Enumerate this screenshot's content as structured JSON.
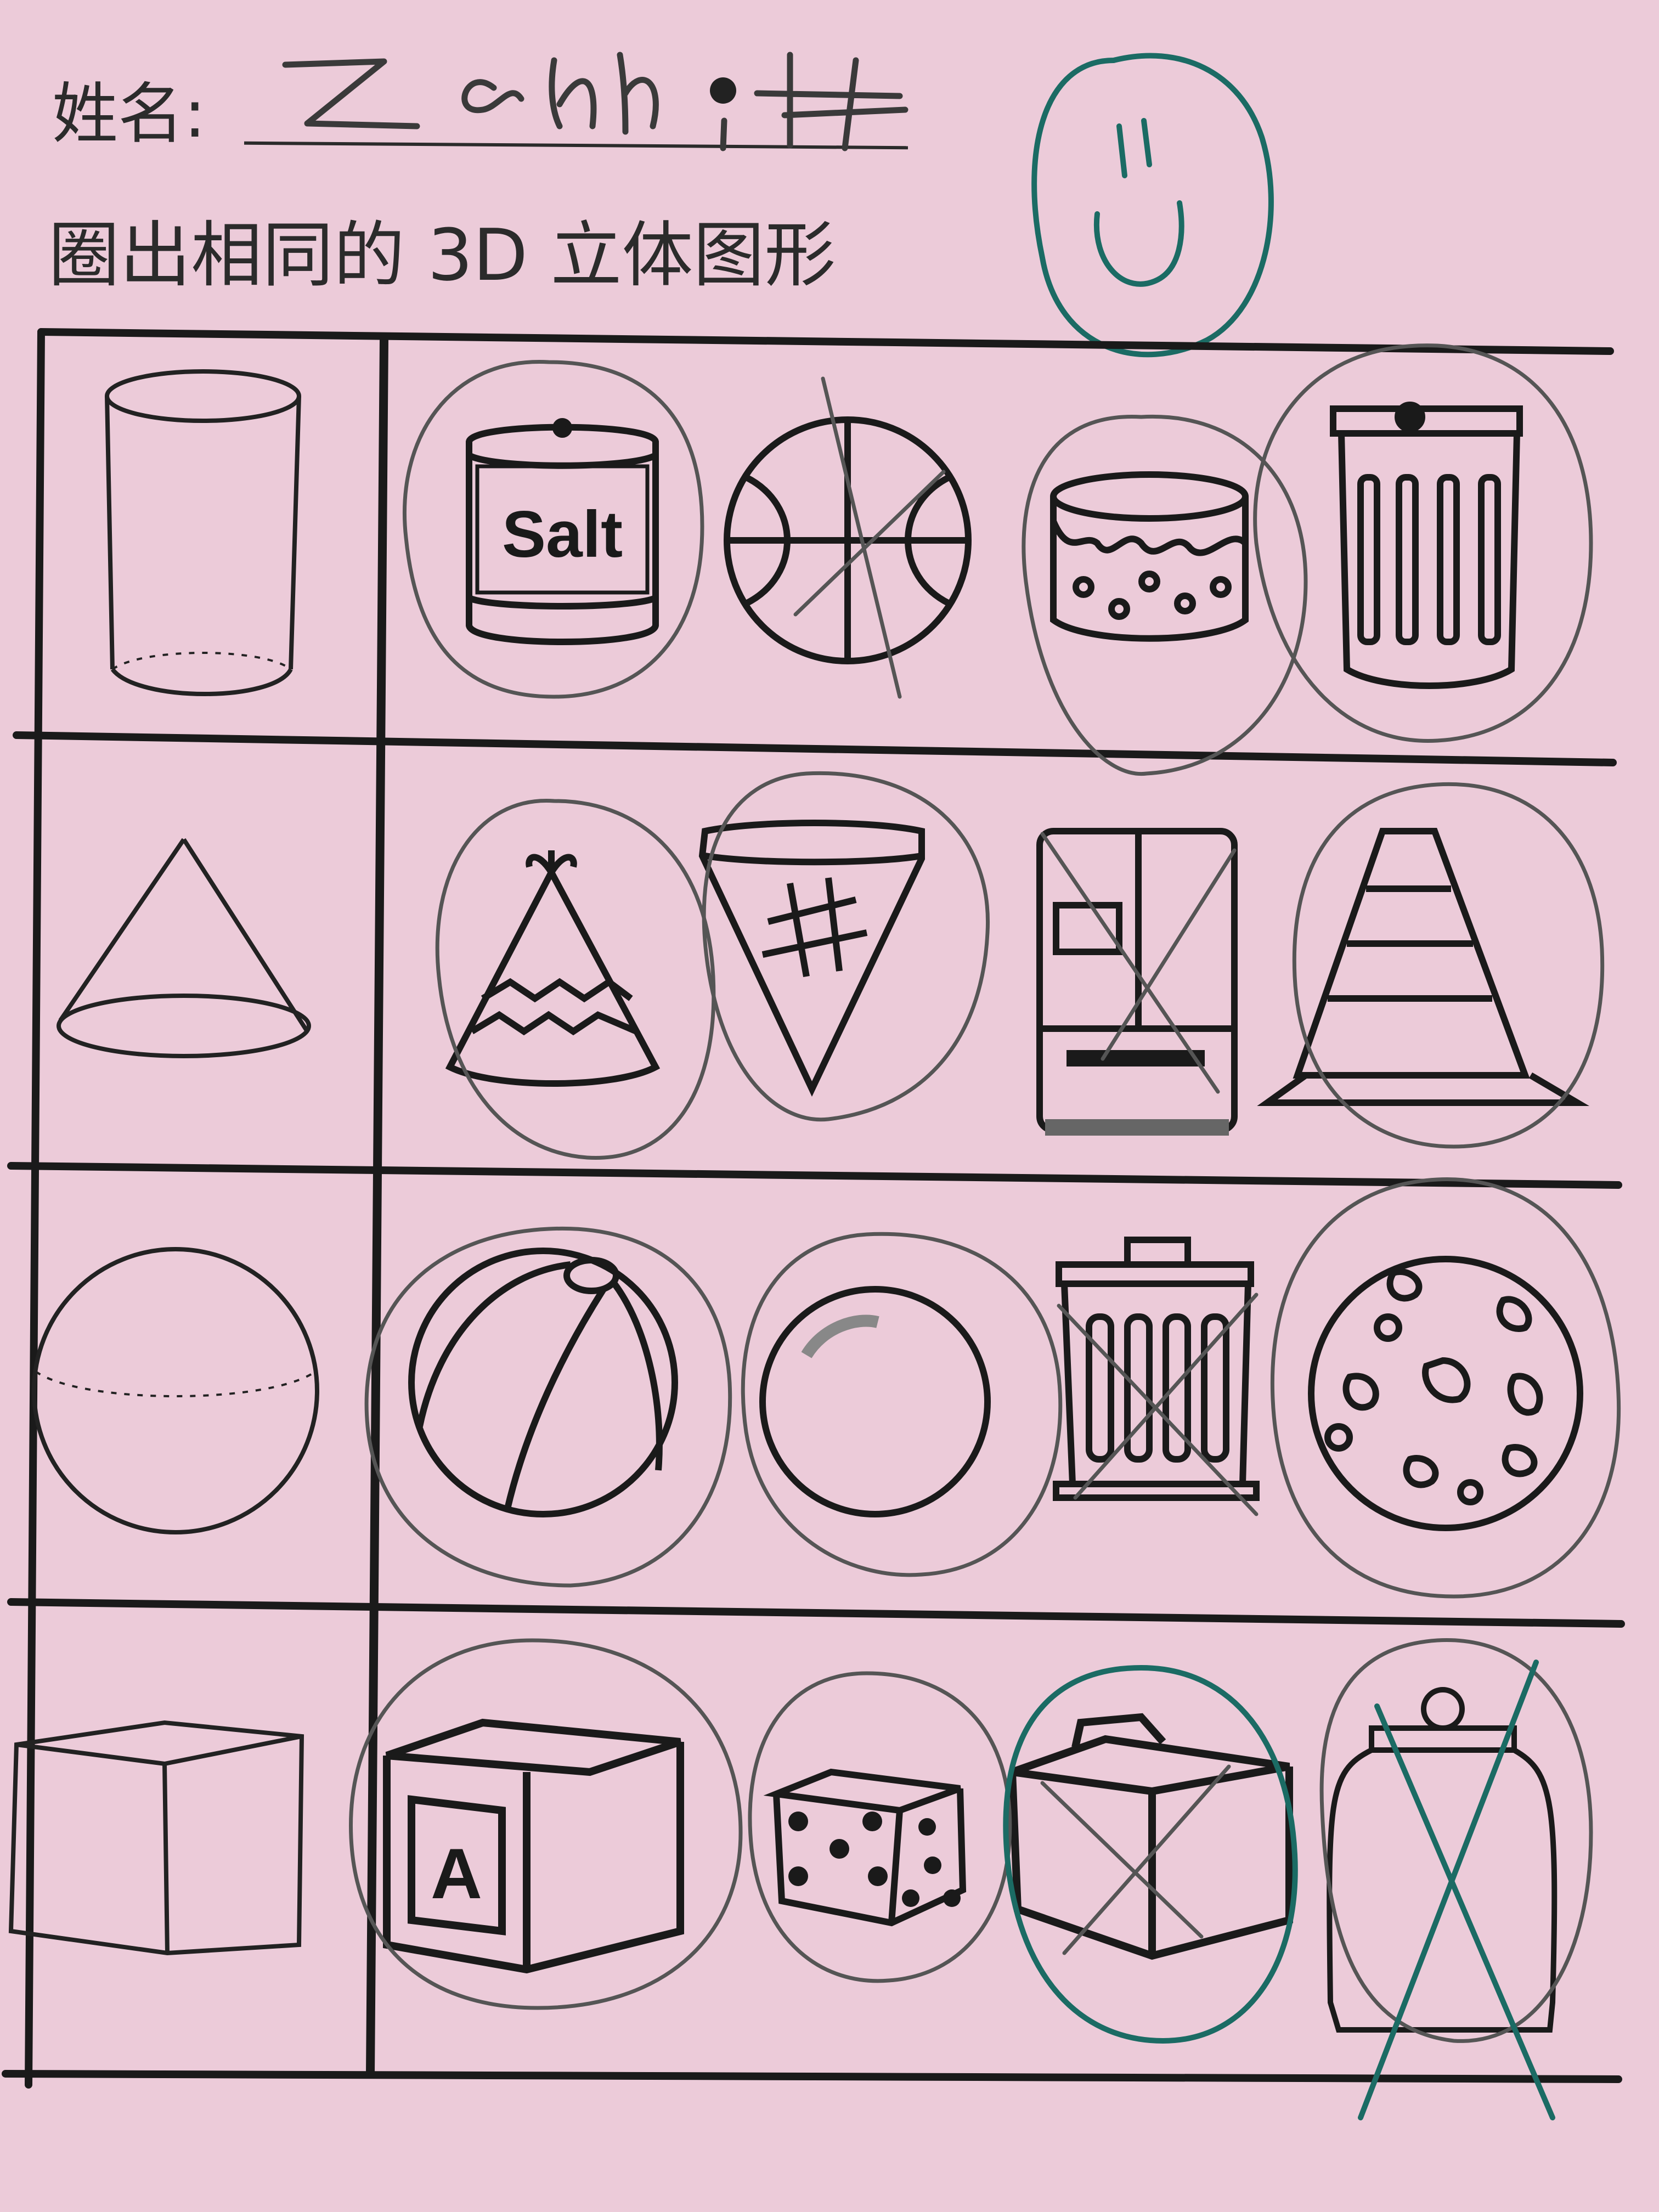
{
  "header": {
    "name_label": "姓名:",
    "name_value": "Zachary",
    "instruction": "圈出相同的 3D 立体图形"
  },
  "worksheet": {
    "rows": [
      {
        "reference_shape": "cylinder",
        "choices": [
          {
            "icon": "salt-can-icon",
            "label": "Salt",
            "circled": true,
            "crossed": false
          },
          {
            "icon": "basketball-icon",
            "circled": false,
            "crossed": true
          },
          {
            "icon": "cake-icon",
            "circled": true,
            "crossed": false
          },
          {
            "icon": "trash-can-icon",
            "circled": true,
            "crossed": false
          }
        ]
      },
      {
        "reference_shape": "cone",
        "choices": [
          {
            "icon": "party-hat-icon",
            "circled": true,
            "crossed": false
          },
          {
            "icon": "pizza-slice-icon",
            "circled": true,
            "crossed": false
          },
          {
            "icon": "refrigerator-icon",
            "circled": false,
            "crossed": true
          },
          {
            "icon": "traffic-cone-icon",
            "circled": true,
            "crossed": false
          }
        ]
      },
      {
        "reference_shape": "sphere",
        "choices": [
          {
            "icon": "beach-ball-icon",
            "circled": true,
            "crossed": false
          },
          {
            "icon": "marble-icon",
            "circled": true,
            "crossed": false
          },
          {
            "icon": "trash-bin-icon",
            "circled": false,
            "crossed": true
          },
          {
            "icon": "cookie-icon",
            "circled": true,
            "crossed": false
          }
        ]
      },
      {
        "reference_shape": "cube",
        "choices": [
          {
            "icon": "letter-block-icon",
            "label": "A",
            "circled": true,
            "crossed": false
          },
          {
            "icon": "dice-icon",
            "circled": true,
            "crossed": false
          },
          {
            "icon": "gift-box-icon",
            "circled": true,
            "crossed": true
          },
          {
            "icon": "jar-icon",
            "circled": false,
            "crossed": true
          }
        ]
      }
    ]
  },
  "teacher_mark": "smiley-face",
  "colors": {
    "paper": "#eccbd9",
    "ink": "#1a1a1a",
    "pencil": "#4a4a4a",
    "teacher_pen": "#1b6b64"
  }
}
